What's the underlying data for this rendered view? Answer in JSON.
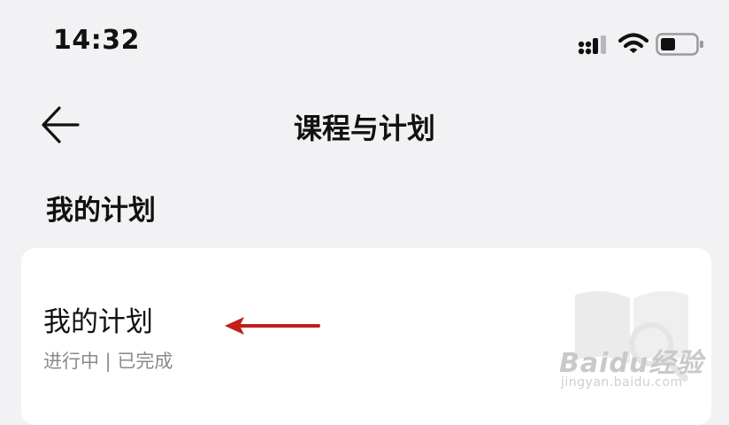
{
  "status_bar": {
    "time": "14:32"
  },
  "nav": {
    "title": "课程与计划"
  },
  "section": {
    "header": "我的计划"
  },
  "card": {
    "title": "我的计划",
    "subtitle": "进行中 | 已完成"
  },
  "watermark": {
    "brand": "Baidu经验",
    "url": "jingyan.baidu.com"
  },
  "colors": {
    "background": "#f2f2f4",
    "card": "#ffffff",
    "annotation_arrow": "#c0201a"
  }
}
